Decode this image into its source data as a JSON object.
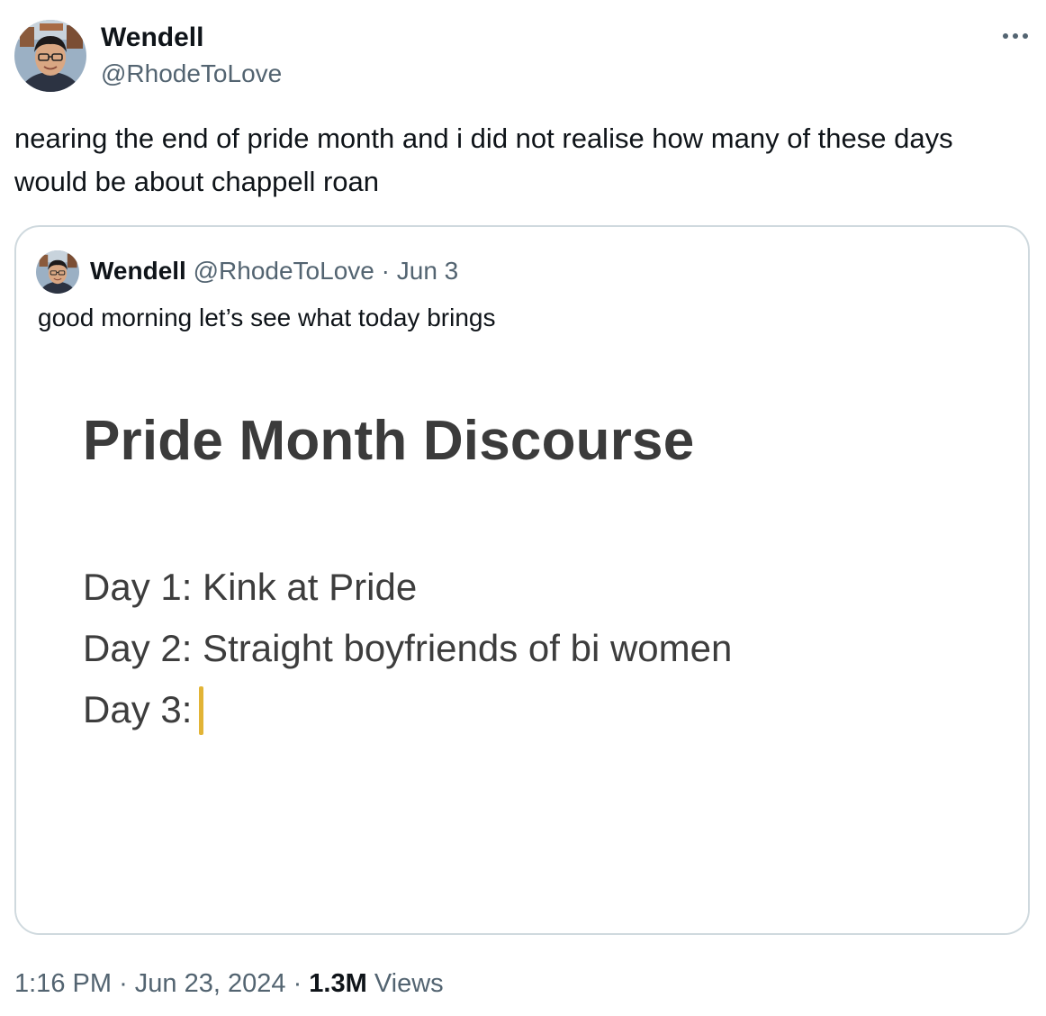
{
  "tweet": {
    "author": {
      "name": "Wendell",
      "handle": "@RhodeToLove",
      "avatar_icon": "profile-photo-avatar"
    },
    "more_icon": "more-horizontal-icon",
    "text": "nearing the end of pride month and i did not realise how many of these days would be about chappell roan",
    "quoted_tweet": {
      "author": {
        "name": "Wendell",
        "handle": "@RhodeToLove"
      },
      "separator": "·",
      "date": "Jun 3",
      "text": "good morning let’s see what today brings",
      "image": {
        "title": "Pride Month Discourse",
        "lines": [
          "Day 1: Kink at Pride",
          "Day 2: Straight boyfriends of bi women",
          "Day 3:"
        ],
        "cursor_color": "#e2b436"
      }
    },
    "footer": {
      "time": "1:16 PM",
      "separator": "·",
      "date": "Jun 23, 2024",
      "views_count": "1.3M",
      "views_label": "Views"
    }
  },
  "colors": {
    "text_primary": "#0f1419",
    "text_secondary": "#536471",
    "border": "#cfd9de"
  }
}
